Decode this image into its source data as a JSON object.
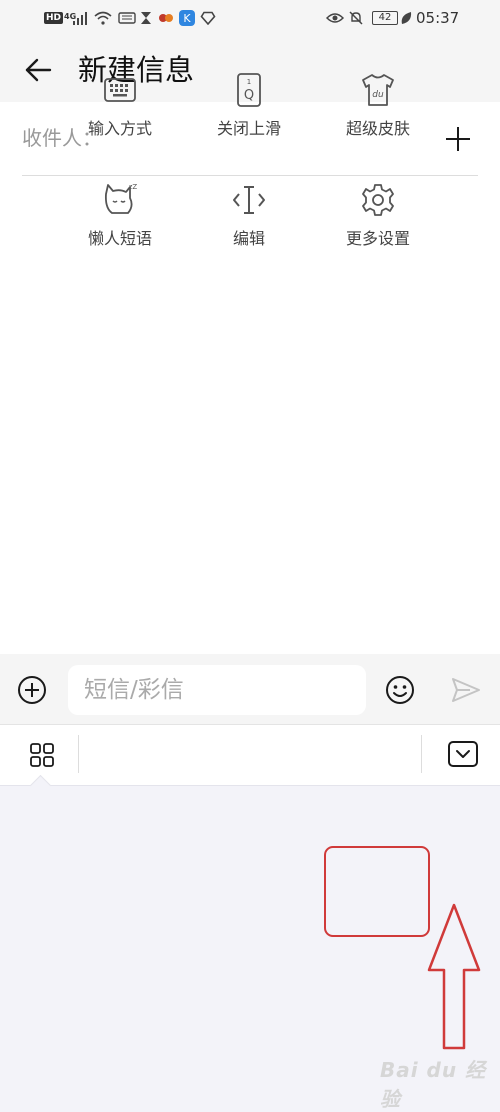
{
  "status_bar": {
    "left_badges": [
      "HD",
      "4G"
    ],
    "time": "05:37",
    "battery": "42"
  },
  "header": {
    "title": "新建信息",
    "back_icon": "arrow-left-icon"
  },
  "recipient": {
    "label": "收件人：",
    "add_icon": "plus-icon"
  },
  "compose": {
    "placeholder": "短信/彩信",
    "value": "",
    "attach_icon": "circle-plus-icon",
    "emoji_icon": "smiley-icon",
    "send_icon": "send-icon"
  },
  "keyboard_toolbar": {
    "grid_icon": "grid-icon",
    "collapse_icon": "chevron-down-box-icon"
  },
  "keyboard_panel": {
    "tiles": [
      {
        "label": "输入方式",
        "icon": "keyboard-icon"
      },
      {
        "label": "关闭上滑",
        "icon": "key-q-icon"
      },
      {
        "label": "超级皮肤",
        "icon": "tshirt-du-icon"
      },
      {
        "label": "懒人短语",
        "icon": "sleepy-cat-icon"
      },
      {
        "label": "编辑",
        "icon": "text-cursor-icon"
      },
      {
        "label": "更多设置",
        "icon": "gear-icon"
      }
    ],
    "key_q_glyph": "Q",
    "key_q_number": "1",
    "tshirt_glyph": "du",
    "sleep_glyph": "zZ"
  },
  "colors": {
    "annotation": "#d03a3a",
    "panel_bg": "#f3f3f9",
    "header_bg": "#f5f5f5"
  },
  "watermark": "Bai du 经验"
}
